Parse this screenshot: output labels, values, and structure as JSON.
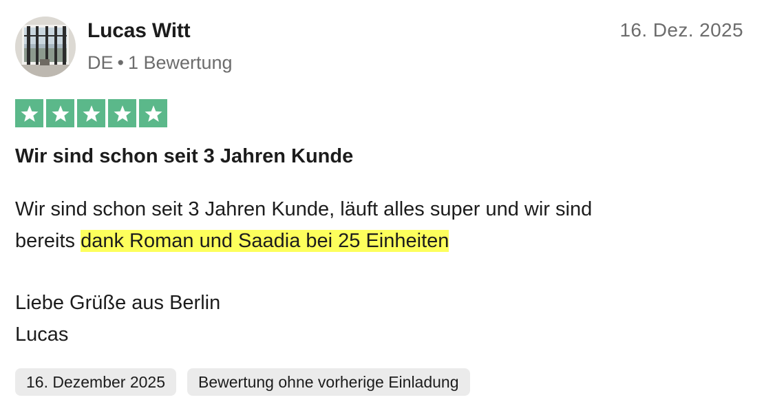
{
  "reviewer": {
    "name": "Lucas Witt",
    "country": "DE",
    "separator": "•",
    "review_count": "1 Bewertung"
  },
  "review": {
    "date_short": "16. Dez. 2025",
    "rating": 5,
    "rating_max": 5,
    "star_color": "#5bb88a",
    "title": "Wir sind schon seit 3 Jahren Kunde",
    "body_line1": "Wir sind schon seit 3 Jahren Kunde, läuft alles super und wir sind",
    "body_line2_plain": "bereits ",
    "body_line2_highlight": "dank Roman und Saadia bei 25 Einheiten",
    "highlight_color": "#fdff5c",
    "greeting": "Liebe Grüße aus Berlin",
    "signature": "Lucas"
  },
  "tags": {
    "date_long": "16. Dezember 2025",
    "invitation": "Bewertung ohne vorherige Einladung"
  }
}
